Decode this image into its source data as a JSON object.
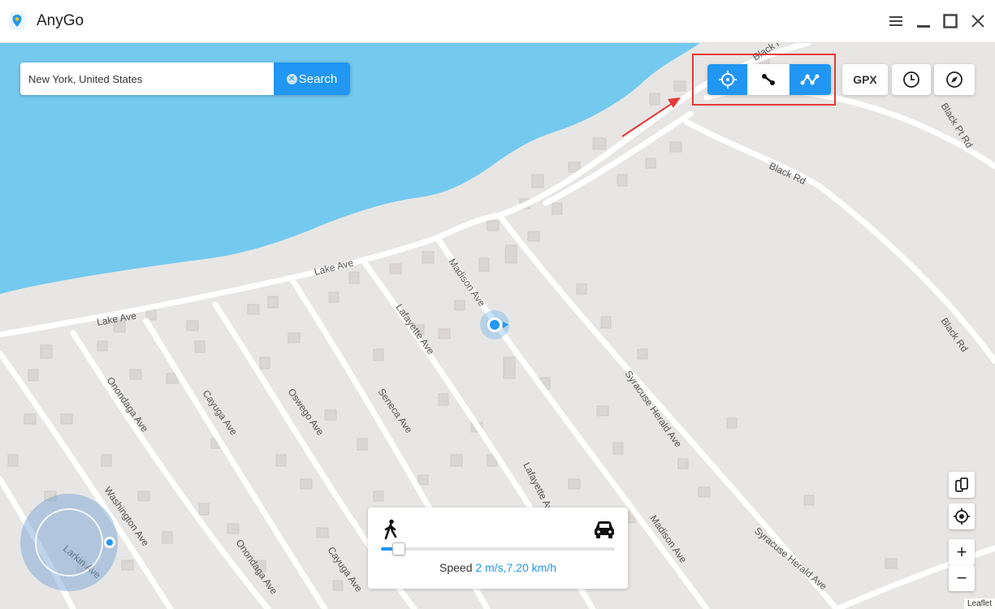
{
  "window": {
    "title": "AnyGo",
    "icon": "map-pin-icon",
    "controls": [
      "menu-icon",
      "minimize-icon",
      "maximize-icon",
      "close-icon"
    ]
  },
  "search": {
    "value": "New York, United States",
    "placeholder": "",
    "button_label": "Search"
  },
  "modes": [
    {
      "name": "teleport-mode",
      "icon": "crosshair-icon",
      "active": true
    },
    {
      "name": "two-spot-mode",
      "icon": "two-spot-route-icon",
      "active": false
    },
    {
      "name": "multi-spot-mode",
      "icon": "multi-spot-route-icon",
      "active": true
    }
  ],
  "tools": {
    "gpx_label": "GPX",
    "history_icon": "clock-icon",
    "compass_icon": "compass-icon"
  },
  "side_controls": [
    "device-switch-icon",
    "locate-icon",
    "zoom-in-icon",
    "zoom-out-icon"
  ],
  "side_glyphs": {
    "zoom_in": "+",
    "zoom_out": "−"
  },
  "map": {
    "streets": [
      "Black Pt Rd",
      "Black Pt Rd",
      "Black Rd",
      "Black Rd",
      "Lake Ave",
      "Lake Ave",
      "Madison Ave",
      "Madison Ave",
      "Lafayette Ave",
      "Lafayette Ave",
      "Seneca Ave",
      "Oswego Ave",
      "Cayuga Ave",
      "Cayuga Ave",
      "Onondaga Ave",
      "Onondaga Ave",
      "Washington Ave",
      "Larkin Ave",
      "Syracuse Herald Ave",
      "Syracuse Herald Ave"
    ],
    "attribution": "Leaflet",
    "water_color": "#74c9ef",
    "land_color": "#e7e6e4"
  },
  "speed": {
    "label": "Speed",
    "value": "2 m/s,7.20 km/h",
    "level": 0.05,
    "walk_icon": "walking-icon",
    "car_icon": "car-icon"
  },
  "colors": {
    "accent": "#2196f3",
    "highlight": "#e53935"
  }
}
